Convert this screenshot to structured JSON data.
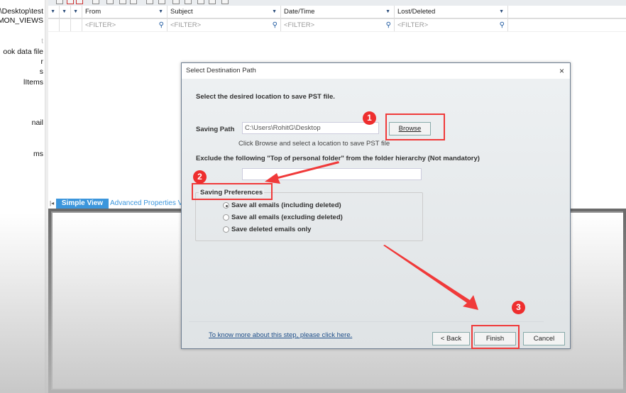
{
  "sidebar": {
    "items": [
      "G\\Desktop\\test",
      "MON_VIEWS",
      "t",
      "ook data file",
      "r",
      "s",
      "lItems",
      "nail",
      "ms"
    ]
  },
  "grid": {
    "columns": [
      "From",
      "Subject",
      "Date/Time",
      "Lost/Deleted"
    ],
    "filter_placeholder": "<FILTER>"
  },
  "tabs": {
    "simple": "Simple View",
    "advanced": "Advanced Properties View"
  },
  "dialog": {
    "title": "Select Destination Path",
    "close": "×",
    "instruction": "Select the desired location to save PST file.",
    "saving_path_label": "Saving Path",
    "saving_path_value": "C:\\Users\\RohitG\\Desktop",
    "browse": "Browse",
    "browse_hint": "Click Browse and select a location to save PST file",
    "exclude_label": "Exclude the following \"Top of personal folder\" from the folder hierarchy  (Not mandatory)",
    "exclude_value": "",
    "preferences_title": "Saving Preferences",
    "options": [
      "Save all emails (including deleted)",
      "Save all emails (excluding deleted)",
      "Save deleted emails only"
    ],
    "selected_option": 0,
    "help_link": "To know more about this step, please click here.",
    "back": "< Back",
    "finish": "Finish",
    "cancel": "Cancel"
  },
  "annotations": {
    "steps": [
      "1",
      "2",
      "3"
    ],
    "color": "#f03a3a"
  }
}
